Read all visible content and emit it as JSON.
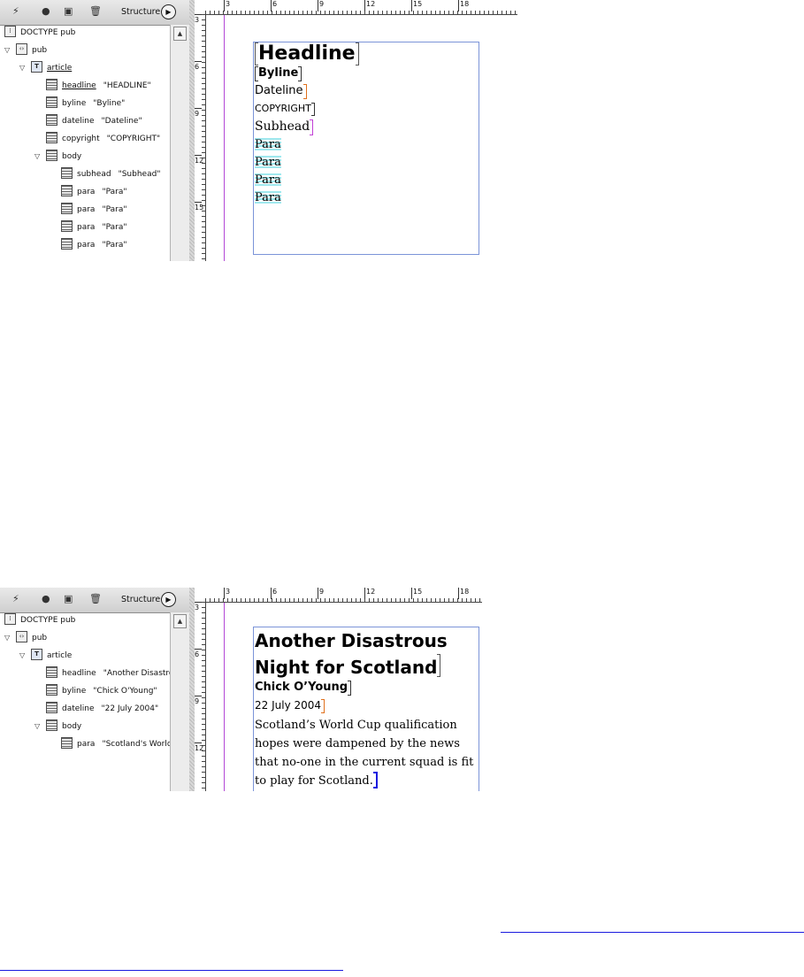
{
  "panel": {
    "title": "Structure",
    "toolbar_icons": [
      "lightning-icon",
      "circle-icon",
      "stop-icon",
      "trash-icon"
    ],
    "menu_icon": "play-circle-icon"
  },
  "shot1": {
    "tree": [
      {
        "label": "DOCTYPE pub",
        "value": "",
        "icon": "doctype",
        "indent": 0,
        "twisty": false
      },
      {
        "label": "pub",
        "value": "",
        "icon": "root",
        "indent": 0,
        "twisty": true
      },
      {
        "label": "article",
        "value": "",
        "icon": "story",
        "indent": 1,
        "twisty": true,
        "underline": true
      },
      {
        "label": "headline",
        "value": "\"HEADLINE\"",
        "icon": "element",
        "indent": 2,
        "twisty": false,
        "underline": true
      },
      {
        "label": "byline",
        "value": "\"Byline\"",
        "icon": "element",
        "indent": 2,
        "twisty": false
      },
      {
        "label": "dateline",
        "value": "\"Dateline\"",
        "icon": "element",
        "indent": 2,
        "twisty": false
      },
      {
        "label": "copyright",
        "value": "\"COPYRIGHT\"",
        "icon": "element",
        "indent": 2,
        "twisty": false
      },
      {
        "label": "body",
        "value": "",
        "icon": "element",
        "indent": 2,
        "twisty": true
      },
      {
        "label": "subhead",
        "value": "\"Subhead\"",
        "icon": "element",
        "indent": 3,
        "twisty": false
      },
      {
        "label": "para",
        "value": "\"Para\"",
        "icon": "element",
        "indent": 3,
        "twisty": false
      },
      {
        "label": "para",
        "value": "\"Para\"",
        "icon": "element",
        "indent": 3,
        "twisty": false
      },
      {
        "label": "para",
        "value": "\"Para\"",
        "icon": "element",
        "indent": 3,
        "twisty": false
      },
      {
        "label": "para",
        "value": "\"Para\"",
        "icon": "element",
        "indent": 3,
        "twisty": false
      }
    ],
    "ruler_h": [
      "3",
      "6",
      "9",
      "12",
      "15",
      "18"
    ],
    "ruler_v": [
      "3",
      "6",
      "9",
      "12",
      "15"
    ],
    "text": {
      "headline": "Headline",
      "byline": "Byline",
      "dateline": "Dateline",
      "copyright": "COPYRIGHT",
      "subhead": "Subhead",
      "paras": [
        "Para",
        "Para",
        "Para",
        "Para"
      ]
    }
  },
  "shot2": {
    "tree": [
      {
        "label": "DOCTYPE pub",
        "value": "",
        "icon": "doctype",
        "indent": 0,
        "twisty": false
      },
      {
        "label": "pub",
        "value": "",
        "icon": "root",
        "indent": 0,
        "twisty": true
      },
      {
        "label": "article",
        "value": "",
        "icon": "story",
        "indent": 1,
        "twisty": true
      },
      {
        "label": "headline",
        "value": "\"Another Disastrou",
        "icon": "element",
        "indent": 2,
        "twisty": false
      },
      {
        "label": "byline",
        "value": "\"Chick O'Young\"",
        "icon": "element",
        "indent": 2,
        "twisty": false
      },
      {
        "label": "dateline",
        "value": "\"22 July 2004\"",
        "icon": "element",
        "indent": 2,
        "twisty": false
      },
      {
        "label": "body",
        "value": "",
        "icon": "element",
        "indent": 2,
        "twisty": true
      },
      {
        "label": "para",
        "value": "\"Scotland's World",
        "icon": "element",
        "indent": 3,
        "twisty": false
      }
    ],
    "ruler_h": [
      "3",
      "6",
      "9",
      "12",
      "15",
      "18"
    ],
    "ruler_v": [
      "3",
      "6",
      "9",
      "12"
    ],
    "text": {
      "headline_1": "Another Disastrous",
      "headline_2": "Night for Scotland",
      "byline": "Chick O’Young",
      "dateline": "22 July 2004",
      "para": "Scotland’s World Cup qualification hopes were dampened by the news that no-one in the current squad is fit to play for Scotland."
    }
  },
  "colors": {
    "frame": "#7b94d8",
    "guide": "#b347d6",
    "headline_marker": "#555555",
    "dateline_marker": "#e0701c",
    "subhead_marker": "#c13fd6",
    "para_marker": "#3ccfdc",
    "link": "#1a1adf"
  }
}
